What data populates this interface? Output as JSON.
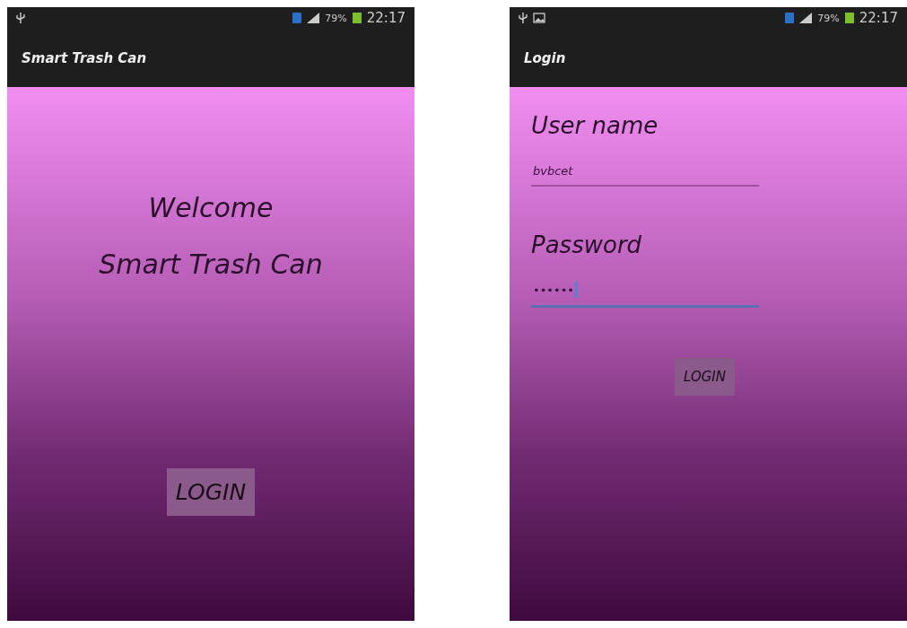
{
  "screens": [
    {
      "status_bar": {
        "notifications": [
          {
            "kind": "usb"
          }
        ],
        "battery": "79%",
        "time": "22:17"
      },
      "title": "Smart Trash Can",
      "kind": "welcome",
      "texts": [
        "Welcome",
        "Smart Trash Can"
      ],
      "button": "LOGIN"
    },
    {
      "status_bar": {
        "notifications": [
          {
            "kind": "usb"
          },
          {
            "kind": "image"
          }
        ],
        "battery": "79%",
        "time": "22:17"
      },
      "title": "Login",
      "kind": "login",
      "fields": [
        {
          "label": "User name",
          "value": "bvbcet",
          "focused": false
        },
        {
          "label": "Password",
          "value": "••••••",
          "focused": true
        }
      ],
      "button": "LOGIN"
    }
  ]
}
